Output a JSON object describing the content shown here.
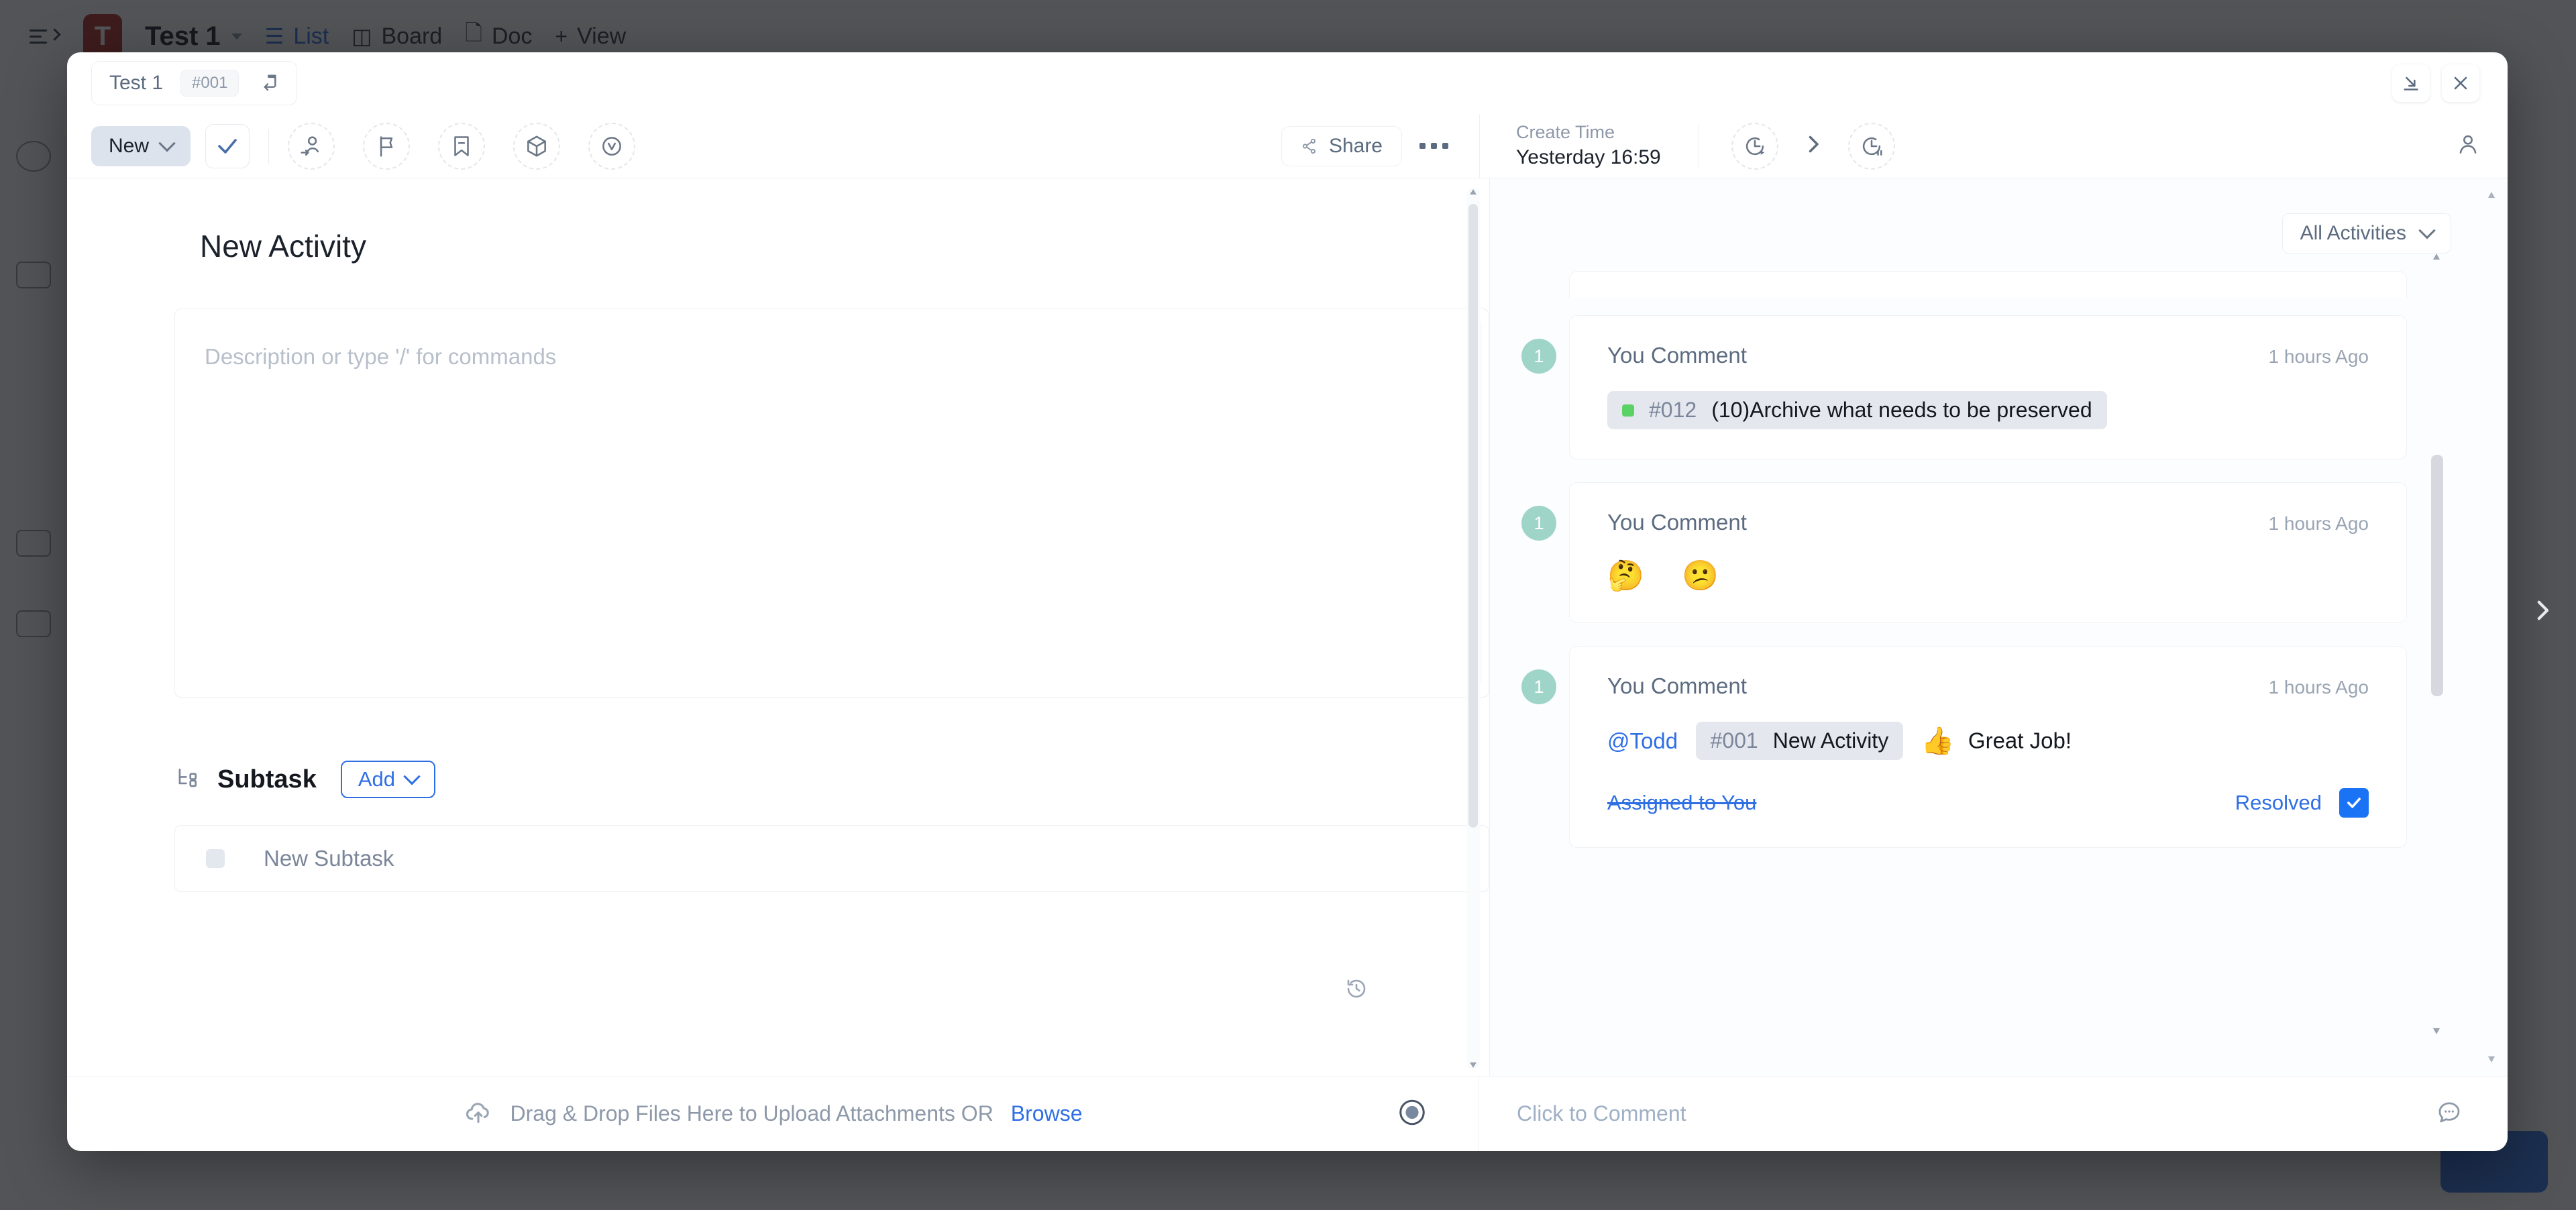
{
  "background": {
    "space_name": "Test 1",
    "logo_letter": "T",
    "tabs": [
      {
        "label": "List",
        "icon": "list-icon",
        "active": true
      },
      {
        "label": "Board",
        "icon": "board-icon",
        "active": false
      },
      {
        "label": "Doc",
        "icon": "doc-icon",
        "active": false
      },
      {
        "label": "View",
        "icon": "plus-icon",
        "active": false
      }
    ]
  },
  "modal": {
    "breadcrumb": {
      "list_name": "Test 1",
      "task_id": "#001",
      "open_icon": "open-in-new-icon"
    },
    "window_controls": {
      "minimize_icon": "collapse-down-icon",
      "close_icon": "close-icon"
    },
    "header": {
      "status_label": "New",
      "status_color": "#dde3ec",
      "complete_icon": "check-icon",
      "actions": [
        {
          "name": "assignee-icon",
          "title": "Assignee"
        },
        {
          "name": "priority-flag-icon",
          "title": "Priority"
        },
        {
          "name": "tag-bookmark-icon",
          "title": "Tags"
        },
        {
          "name": "package-cube-icon",
          "title": "Dependencies"
        },
        {
          "name": "version-icon",
          "title": "Version"
        }
      ],
      "share_label": "Share",
      "share_icon": "share-icon",
      "more_icon": "more-horizontal-icon",
      "create_time_label": "Create Time",
      "create_time_value": "Yesterday 16:59",
      "timer_start_icon": "clock-play-icon",
      "timer_next_icon": "chevron-right-icon",
      "timer_pause_icon": "clock-pause-icon",
      "watcher_icon": "person-icon"
    },
    "left": {
      "title": "New Activity",
      "description_placeholder": "Description or type '/' for commands",
      "history_icon": "history-clock-icon",
      "subtask": {
        "icon": "subtask-tree-icon",
        "label": "Subtask",
        "add_label": "Add",
        "rows": [
          {
            "name": "New Subtask",
            "checkbox_state": "unchecked"
          }
        ]
      }
    },
    "right": {
      "filter_label": "All Activities",
      "filter_icon": "chevron-down-icon",
      "activities": [
        {
          "avatar": "1",
          "who": "You Comment",
          "when": "1 hours Ago",
          "type": "task-reference",
          "ref_id": "#012",
          "ref_title": "(10)Archive what needs to be preserved",
          "ref_dot_color": "#5bd265"
        },
        {
          "avatar": "1",
          "who": "You Comment",
          "when": "1 hours Ago",
          "type": "emoji",
          "emojis": "🤔 😕"
        },
        {
          "avatar": "1",
          "who": "You Comment",
          "when": "1 hours Ago",
          "type": "mention",
          "mention": "@Todd",
          "ref_id": "#001",
          "ref_title": "New Activity",
          "reaction": "👍",
          "message": "Great Job!",
          "assigned_label": "Assigned to You",
          "resolved_label": "Resolved",
          "resolved_checked": true,
          "resolved_color": "#1a73f5"
        }
      ]
    },
    "footer": {
      "upload_icon": "cloud-upload-icon",
      "upload_text": "Drag & Drop Files Here to Upload Attachments OR",
      "browse_label": "Browse",
      "record_icon": "record-icon",
      "comment_placeholder": "Click to Comment",
      "comment_icon": "comment-bubble-icon"
    }
  },
  "page_nav": {
    "next_icon": "chevron-right-icon"
  }
}
